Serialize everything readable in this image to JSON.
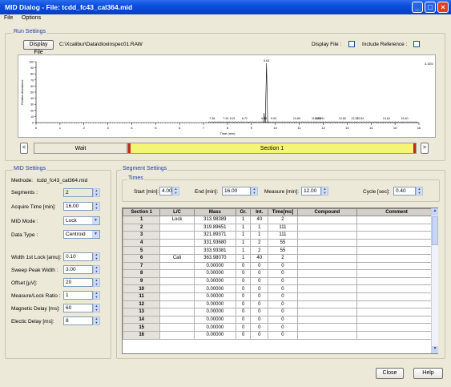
{
  "window": {
    "title": "MID Dialog - File: tcdd_fc43_cal364.mid"
  },
  "menu": [
    "File",
    "Options"
  ],
  "run_settings": {
    "group_label": "Run Settings",
    "display_file_button": "Display File",
    "raw_path": "C:\\Xcalibur\\Data\\dioxinspec01.RAW",
    "display_file_label": "Display File :",
    "include_reference_label": "Include Reference :",
    "plot": {
      "y_axis_label": "Relative Abundance",
      "x_axis_label": "Time (min)",
      "intensity_label": "3.1E5",
      "y_ticks": [
        "100",
        "90",
        "80",
        "70",
        "60",
        "50",
        "40",
        "30",
        "20",
        "10",
        "0"
      ],
      "x_ticks": [
        "0",
        "1",
        "2",
        "3",
        "4",
        "5",
        "6",
        "7",
        "8",
        "9",
        "10",
        "11",
        "12",
        "13",
        "14",
        "15",
        "16"
      ],
      "peak_labels": [
        {
          "text": "7.36",
          "time": 7.36
        },
        {
          "text": "7.93",
          "time": 7.93
        },
        {
          "text": "8.21",
          "time": 8.21
        },
        {
          "text": "8.72",
          "time": 8.72
        },
        {
          "text": "9.53",
          "time": 9.53
        },
        {
          "text": "9.63",
          "time": 9.63
        },
        {
          "text": "9.93",
          "time": 9.93
        },
        {
          "text": "10.89",
          "time": 10.89
        },
        {
          "text": "11.66",
          "time": 11.66
        },
        {
          "text": "11.78",
          "time": 11.78
        },
        {
          "text": "11.91",
          "time": 11.91
        },
        {
          "text": "12.80",
          "time": 12.8
        },
        {
          "text": "13.32",
          "time": 13.32
        },
        {
          "text": "13.54",
          "time": 13.54
        },
        {
          "text": "14.64",
          "time": 14.64
        },
        {
          "text": "15.40",
          "time": 15.4
        }
      ],
      "main_peak_time": 9.63
    },
    "segments": {
      "wait": "Wait",
      "section1": "Section 1",
      "prev": "<",
      "next": ">"
    }
  },
  "mid_settings": {
    "group_label": "MID Settings",
    "method_label": "Methode:",
    "method_value": "tcdd_fc43_cal364.mid",
    "segments_label": "Segments :",
    "segments_value": "2",
    "acquire_time_label": "Acquire Time [min]:",
    "acquire_time_value": "16.00",
    "mid_mode_label": "MID Mode :",
    "mid_mode_value": "Lock",
    "data_type_label": "Data Type :",
    "data_type_value": "Centroid",
    "width_lock_label": "Width 1st Lock [amu]:",
    "width_lock_value": "0.10",
    "sweep_label": "Sweep Peak Width :",
    "sweep_value": "3.00",
    "offset_label": "Offset [µV]:",
    "offset_value": "20",
    "measure_lock_label": "Measure/Lock Ratio :",
    "measure_lock_value": "1",
    "magnetic_label": "Magnetic Delay [ms]:",
    "magnetic_value": "60",
    "electric_label": "Electic Delay [ms]:",
    "electric_value": "8"
  },
  "segment_settings": {
    "group_label": "Segment Settings",
    "times_label": "Times",
    "start_label": "Start [min]:",
    "start_value": "4.00",
    "end_label": "End [min]:",
    "end_value": "16.00",
    "measure_label": "Measure [min]:",
    "measure_value": "12.00",
    "cycle_label": "Cycle [sec]:",
    "cycle_value": "0.40",
    "columns": [
      "Section 1",
      "L/C",
      "Mass",
      "Gr.",
      "Int.",
      "Time[ms]",
      "Compound",
      "Comment"
    ],
    "rows": [
      [
        "1",
        "Lock",
        "313.98389",
        "1",
        "40",
        "2",
        "",
        ""
      ],
      [
        "2",
        "",
        "319.89651",
        "1",
        "1",
        "111",
        "",
        ""
      ],
      [
        "3",
        "",
        "321.89371",
        "1",
        "1",
        "111",
        "",
        ""
      ],
      [
        "4",
        "",
        "331.93680",
        "1",
        "2",
        "55",
        "",
        ""
      ],
      [
        "5",
        "",
        "333.93381",
        "1",
        "2",
        "55",
        "",
        ""
      ],
      [
        "6",
        "Cali",
        "363.98070",
        "1",
        "40",
        "2",
        "",
        ""
      ],
      [
        "7",
        "",
        "0.00000",
        "0",
        "0",
        "0",
        "",
        ""
      ],
      [
        "8",
        "",
        "0.00000",
        "0",
        "0",
        "0",
        "",
        ""
      ],
      [
        "9",
        "",
        "0.00000",
        "0",
        "0",
        "0",
        "",
        ""
      ],
      [
        "10",
        "",
        "0.00000",
        "0",
        "0",
        "0",
        "",
        ""
      ],
      [
        "11",
        "",
        "0.00000",
        "0",
        "0",
        "0",
        "",
        ""
      ],
      [
        "12",
        "",
        "0.00000",
        "0",
        "0",
        "0",
        "",
        ""
      ],
      [
        "13",
        "",
        "0.00000",
        "0",
        "0",
        "0",
        "",
        ""
      ],
      [
        "14",
        "",
        "0.00000",
        "0",
        "0",
        "0",
        "",
        ""
      ],
      [
        "15",
        "",
        "0.00000",
        "0",
        "0",
        "0",
        "",
        ""
      ],
      [
        "16",
        "",
        "0.00000",
        "0",
        "0",
        "0",
        "",
        ""
      ]
    ]
  },
  "buttons": {
    "close": "Close",
    "help": "Help"
  },
  "colors": {
    "title_bar": "#0a4fd8",
    "segment_section": "#f5f575",
    "segment_marker": "#c0281c"
  }
}
